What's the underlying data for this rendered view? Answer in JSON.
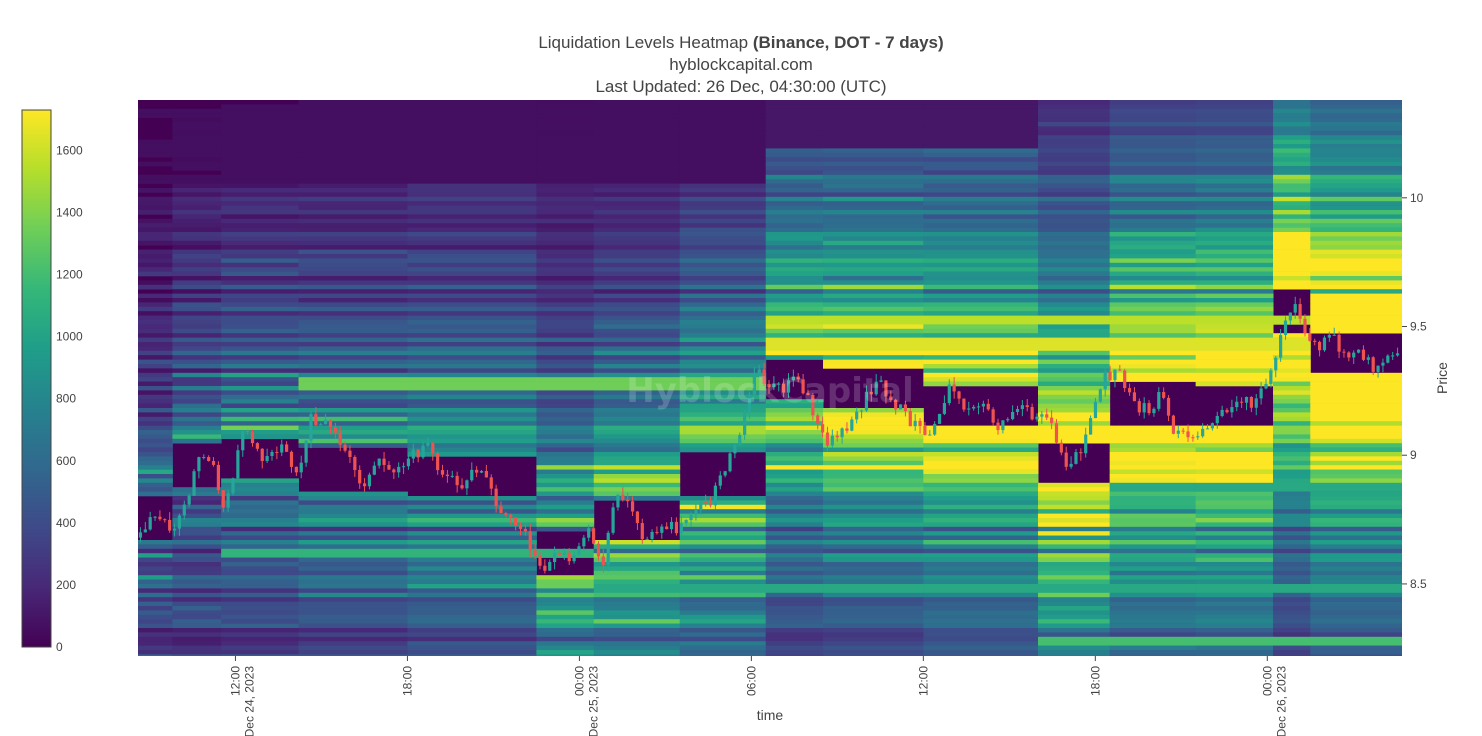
{
  "header": {
    "title_prefix": "Liquidation Levels Heatmap ",
    "title_bold": "(Binance, DOT - 7 days)",
    "subtitle": "hyblockcapital.com",
    "updated": "Last Updated: 26 Dec, 04:30:00 (UTC)"
  },
  "watermark": "HyblockCapital",
  "colors": {
    "background": "#440154",
    "up": "#26a69a",
    "down": "#ef5350",
    "scale": [
      "#440154",
      "#482878",
      "#3e4a89",
      "#31688e",
      "#26828e",
      "#1f9e89",
      "#35b779",
      "#6ece58",
      "#b5de2b",
      "#fde725"
    ]
  },
  "chart_data": {
    "type": "heatmap",
    "title": "Liquidation Levels Heatmap (Binance, DOT - 7 days)",
    "xlabel": "time",
    "ylabel": "Price",
    "x_ticks": [
      {
        "line1": "12:00",
        "line2": "Dec 24, 2023",
        "hour": 12
      },
      {
        "line1": "18:00",
        "line2": "",
        "hour": 18
      },
      {
        "line1": "00:00",
        "line2": "Dec 25, 2023",
        "hour": 24
      },
      {
        "line1": "06:00",
        "line2": "",
        "hour": 30
      },
      {
        "line1": "12:00",
        "line2": "",
        "hour": 36
      },
      {
        "line1": "18:00",
        "line2": "",
        "hour": 42
      },
      {
        "line1": "00:00",
        "line2": "Dec 26, 2023",
        "hour": 48
      }
    ],
    "x_range_hours": [
      8.6,
      52.7
    ],
    "y_ticks": [
      8.5,
      9,
      9.5,
      10
    ],
    "y_range": [
      8.22,
      10.38
    ],
    "colorbar": {
      "ticks": [
        0,
        200,
        400,
        600,
        800,
        1000,
        1200,
        1400,
        1600
      ],
      "range": [
        0,
        1730
      ]
    },
    "price_path": [
      [
        8.6,
        8.68
      ],
      [
        9.3,
        8.77
      ],
      [
        9.8,
        8.72
      ],
      [
        10.3,
        8.82
      ],
      [
        10.7,
        8.98
      ],
      [
        11.2,
        9.0
      ],
      [
        11.6,
        8.78
      ],
      [
        12.3,
        9.12
      ],
      [
        12.9,
        8.98
      ],
      [
        13.6,
        9.02
      ],
      [
        14.2,
        8.94
      ],
      [
        14.6,
        9.14
      ],
      [
        15.2,
        9.12
      ],
      [
        15.8,
        9.02
      ],
      [
        16.4,
        8.87
      ],
      [
        17.0,
        8.97
      ],
      [
        17.6,
        8.92
      ],
      [
        18.2,
        9.0
      ],
      [
        18.7,
        9.03
      ],
      [
        19.3,
        8.92
      ],
      [
        19.9,
        8.88
      ],
      [
        20.6,
        8.96
      ],
      [
        21.2,
        8.76
      ],
      [
        21.7,
        8.75
      ],
      [
        22.2,
        8.68
      ],
      [
        22.7,
        8.53
      ],
      [
        23.3,
        8.63
      ],
      [
        23.8,
        8.6
      ],
      [
        24.3,
        8.72
      ],
      [
        24.8,
        8.56
      ],
      [
        25.3,
        8.87
      ],
      [
        25.8,
        8.8
      ],
      [
        26.3,
        8.66
      ],
      [
        26.8,
        8.72
      ],
      [
        27.4,
        8.72
      ],
      [
        28.0,
        8.78
      ],
      [
        28.6,
        8.83
      ],
      [
        29.2,
        8.98
      ],
      [
        29.7,
        9.13
      ],
      [
        30.2,
        9.33
      ],
      [
        30.6,
        9.28
      ],
      [
        31.1,
        9.26
      ],
      [
        31.6,
        9.3
      ],
      [
        32.1,
        9.18
      ],
      [
        32.6,
        9.06
      ],
      [
        33.1,
        9.08
      ],
      [
        33.6,
        9.14
      ],
      [
        34.0,
        9.23
      ],
      [
        34.5,
        9.28
      ],
      [
        35.0,
        9.2
      ],
      [
        35.6,
        9.13
      ],
      [
        36.3,
        9.07
      ],
      [
        36.9,
        9.26
      ],
      [
        37.5,
        9.15
      ],
      [
        38.1,
        9.2
      ],
      [
        38.7,
        9.1
      ],
      [
        39.3,
        9.2
      ],
      [
        39.9,
        9.15
      ],
      [
        40.4,
        9.16
      ],
      [
        40.8,
        9.0
      ],
      [
        41.1,
        8.94
      ],
      [
        41.7,
        9.08
      ],
      [
        42.3,
        9.3
      ],
      [
        42.8,
        9.33
      ],
      [
        43.3,
        9.2
      ],
      [
        43.8,
        9.18
      ],
      [
        44.3,
        9.23
      ],
      [
        44.8,
        9.08
      ],
      [
        45.3,
        9.06
      ],
      [
        45.9,
        9.12
      ],
      [
        46.5,
        9.16
      ],
      [
        47.1,
        9.22
      ],
      [
        47.6,
        9.2
      ],
      [
        48.1,
        9.32
      ],
      [
        48.6,
        9.52
      ],
      [
        49.0,
        9.58
      ],
      [
        49.3,
        9.46
      ],
      [
        49.8,
        9.42
      ],
      [
        50.3,
        9.46
      ],
      [
        50.8,
        9.38
      ],
      [
        51.3,
        9.4
      ],
      [
        51.8,
        9.33
      ],
      [
        52.3,
        9.4
      ],
      [
        52.7,
        9.4
      ]
    ],
    "grid": false,
    "colorbar_position": "left"
  }
}
